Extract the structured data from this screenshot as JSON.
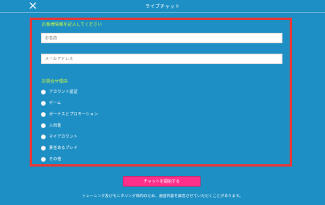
{
  "window": {
    "title": "ライブチャット"
  },
  "header": {
    "close_icon": "close-icon"
  },
  "form": {
    "customer_section_title": "お客様情報を記入してください",
    "name_placeholder": "お名前",
    "email_placeholder": "メールアドレス",
    "reason_section_title": "お問合せ理由",
    "reasons": [
      "アカウント認証",
      "ゲーム",
      "ボーナスとプロモーション",
      "入出金",
      "マイアカウント",
      "責任あるプレイ",
      "その他"
    ]
  },
  "actions": {
    "start_chat": "チャットを開始する"
  },
  "footer": {
    "note": "トレーニング及びモニタリング目的のため、通話内容を録音させていただくことがあります。"
  },
  "colors": {
    "background": "#1e8fc4",
    "frame": "#e23a3a",
    "section_title": "#d8ff3a",
    "button": "#ff2f8a"
  }
}
